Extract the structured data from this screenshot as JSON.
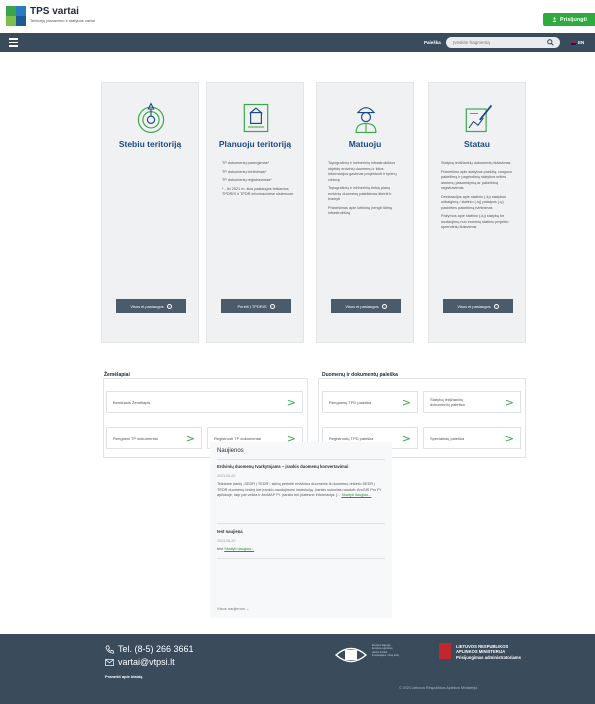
{
  "header": {
    "title": "TPS vartai",
    "subtitle": "Teritorijų planavimo ir statybos vartai",
    "login_label": "Prisijungti",
    "logo_colors": [
      "#3da34a",
      "#2a7bbf",
      "#7cc04b",
      "#1d5a8f"
    ]
  },
  "navbar": {
    "search_label": "Paieška",
    "search_placeholder": "Įveskite fragmentą",
    "lang_label": "EN"
  },
  "cards": [
    {
      "title": "Stebiu teritoriją",
      "icon": "eye-map-icon",
      "paragraphs": [],
      "button": "Visos el.paslaugos"
    },
    {
      "title": "Planuoju teritoriją",
      "icon": "planning-document-icon",
      "paragraphs": [
        "TP dokumentų parengimas*",
        "TP dokumentų tvirtinimas*",
        "TP dokumentų registravimas*",
        "* - Iki 2021 m. šios paslaugos teikiamos TPDRIS ir TPDR informacinėse sistemose."
      ],
      "button": "Pereiti į TPDRIS"
    },
    {
      "title": "Matuoju",
      "icon": "surveyor-icon",
      "paragraphs": [
        "Topografinių ir inžinerinių infrastruktūros objektų erdvinių duomenų ir kitos informacijos gavimas projektuoti ir tyrimų vietovę",
        "Topografinių ir inžinerinių tinklų planų erdvinių duomenų pateikimas tikrinti ir tvarkyti",
        "Pranešimas apie kelininę įrengti tūrinę infrastruktūrą"
      ],
      "button": "Visos el.paslaugos"
    },
    {
      "title": "Statau",
      "icon": "building-pencil-icon",
      "paragraphs": [
        "Statybą leidžiančių dokumentų išdavimas",
        "Pranešimo apie statybos pradžią, rangovo pakeitimą ir pagrindinių statybos srities asmenų pasamdymą ar pakeitimą registravimas",
        "Deklaracijos apie statinio (-ių) statybos užbaigimą / statinio (-ių) patalpos (-ų) paskirties pakeitimą tvirtinimas",
        "Pažymos apie statinio (-ių) statybą be nuolaujimų nuo esminių statinio projekto sprendinių išdavimas"
      ],
      "button": "Visos el.paslaugos"
    }
  ],
  "maps": {
    "title": "Žemėlapiai",
    "items": [
      "Bendrasis Žemėlapis",
      "Rengiami TP dokumentai",
      "Registruoti TP dokumentai"
    ]
  },
  "docs": {
    "title": "Duomenų ir dokumentų paieška",
    "items": [
      "Rengiamų TPD paieška",
      "Statybą leidžiančių dokumentų paieška",
      "Registruotų TPD paieška",
      "Specialistų paieška"
    ]
  },
  "news": {
    "title": "Naujienos",
    "items": [
      {
        "title": "Erdvinių duomenų tvarkytojams – įrankis duomenų konvertavimui",
        "date": "2023-06-20",
        "text": "Teikiame įrankį „SEDR į TEDR“, skirtą perkelti erdvinius duomenis iš duomenų rinkinio SEDR į TEDR duomenų rinkinį bei įrankio naudojimosi instrukciją. Įrankis sukurtas naudoti: ArcGIS Pro PI aplinkoje, taip pat veikia ir ArcMAP PI. Įrankis bei platesnė informacija: [...",
        "more": "Skaityti daugiau..."
      },
      {
        "title": "test naujiena",
        "date": "2023-06-20",
        "text": "test",
        "more": "Skaityti daugiau..."
      }
    ],
    "all_label": "Visos naujienos ⌄"
  },
  "footer": {
    "phone": "Tel. (8-5) 266 3661",
    "email": "vartai@vtpsi.lt",
    "report": "Pranešti apie klaidą",
    "eu_text": "Europos Sąjunga, Europos regioninės plėtros fondas. Investuojame į Jūsų ateitį",
    "ministry_line1": "LIETUVOS RESPUBLIKOS",
    "ministry_line2": "APLINKOS MINISTERIJA",
    "ministry_sub": "Prisijungimas administratoriams",
    "copyright": "© 2023 Lietuvos Respublikos Aplinkos Ministerija."
  }
}
